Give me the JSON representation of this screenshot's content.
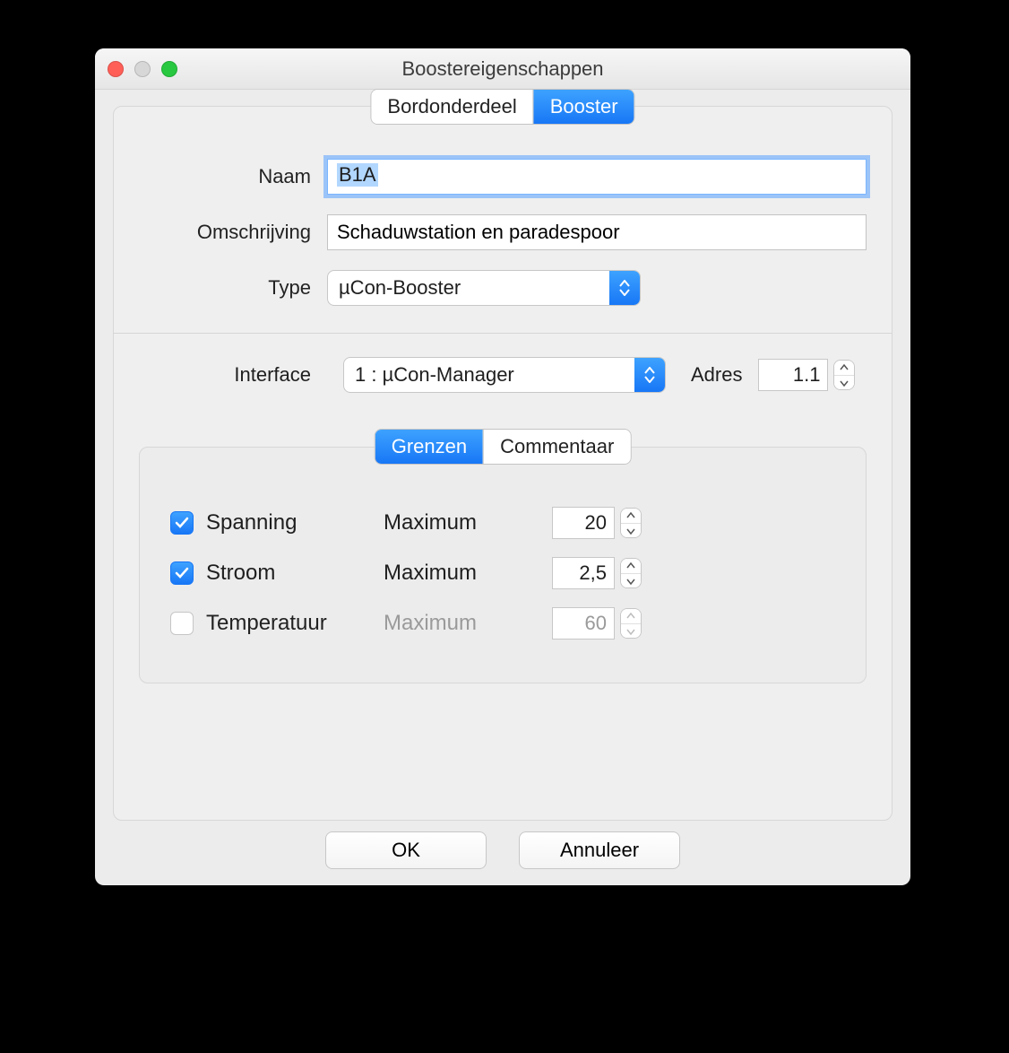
{
  "window": {
    "title": "Boostereigenschappen"
  },
  "tabs": {
    "left": "Bordonderdeel",
    "right": "Booster"
  },
  "form": {
    "naam_label": "Naam",
    "naam_value": "B1A",
    "omschrijving_label": "Omschrijving",
    "omschrijving_value": "Schaduwstation en paradespoor",
    "type_label": "Type",
    "type_value": "µCon-Booster",
    "interface_label": "Interface",
    "interface_value": "1 : µCon-Manager",
    "adres_label": "Adres",
    "adres_value": "1.1"
  },
  "limits": {
    "tab_left": "Grenzen",
    "tab_right": "Commentaar",
    "spanning_label": "Spanning",
    "spanning_checked": true,
    "spanning_max_label": "Maximum",
    "spanning_max_value": "20",
    "stroom_label": "Stroom",
    "stroom_checked": true,
    "stroom_max_label": "Maximum",
    "stroom_max_value": "2,5",
    "temperatuur_label": "Temperatuur",
    "temperatuur_checked": false,
    "temperatuur_max_label": "Maximum",
    "temperatuur_max_value": "60"
  },
  "buttons": {
    "ok": "OK",
    "cancel": "Annuleer"
  }
}
